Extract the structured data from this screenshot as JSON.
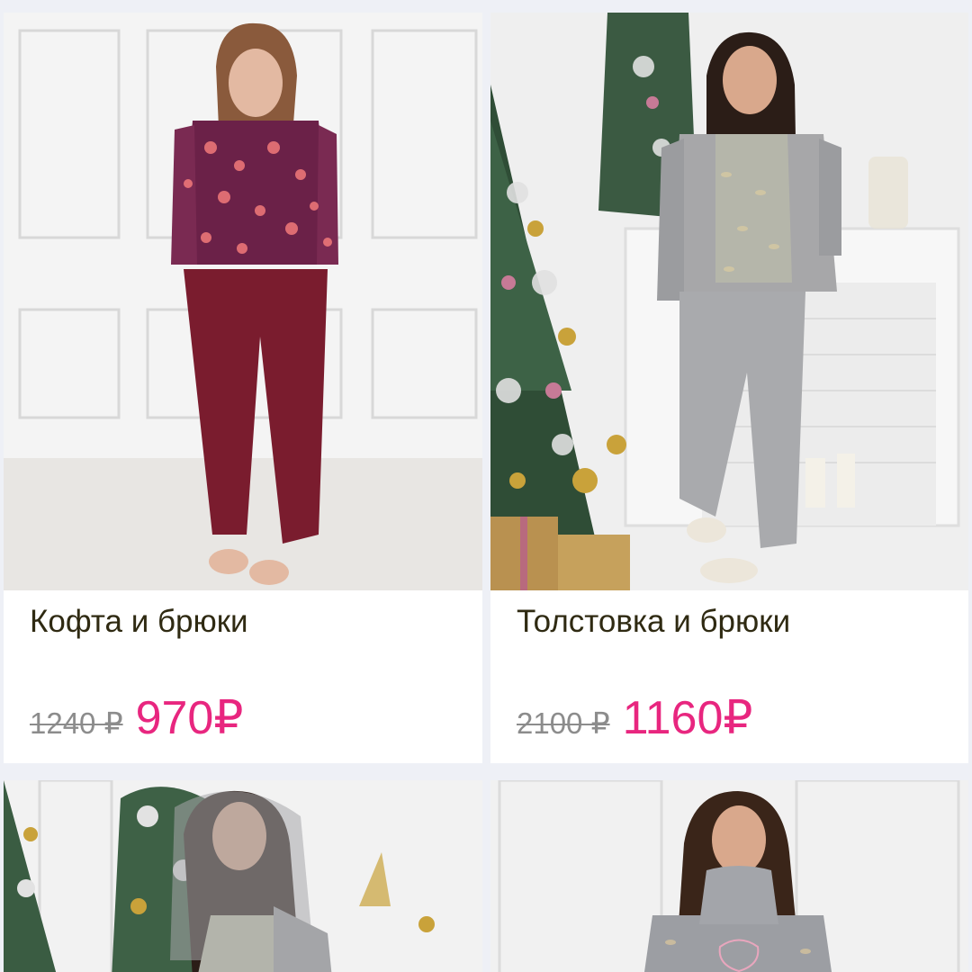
{
  "products": [
    {
      "title": "Кофта и брюки",
      "old_price": "1240 ₽",
      "new_price": "970₽"
    },
    {
      "title": "Толстовка и брюки",
      "old_price": "2100 ₽",
      "new_price": "1160₽"
    },
    {
      "title": "",
      "old_price": "",
      "new_price": ""
    },
    {
      "title": "",
      "old_price": "",
      "new_price": ""
    }
  ],
  "colors": {
    "background": "#eef0f6",
    "card": "#ffffff",
    "title_text": "#2f2a12",
    "old_price": "#8c8c8c",
    "sale_price": "#e8267f"
  }
}
